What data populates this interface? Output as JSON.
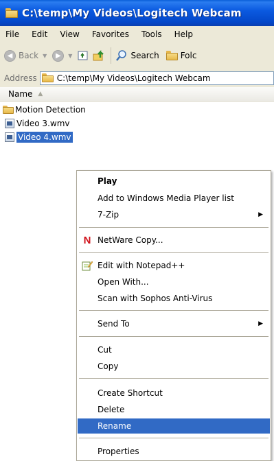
{
  "window": {
    "title": "C:\\temp\\My Videos\\Logitech Webcam"
  },
  "menubar": {
    "items": [
      "File",
      "Edit",
      "View",
      "Favorites",
      "Tools",
      "Help"
    ]
  },
  "toolbar": {
    "back_label": "Back",
    "search_label": "Search",
    "folders_label": "Folc"
  },
  "address": {
    "label": "Address",
    "path": "C:\\temp\\My Videos\\Logitech Webcam"
  },
  "columns": {
    "name": "Name"
  },
  "files": [
    {
      "name": "Motion Detection",
      "type": "folder"
    },
    {
      "name": "Video 3.wmv",
      "type": "video"
    },
    {
      "name": "Video 4.wmv",
      "type": "video",
      "selected": true
    }
  ],
  "context_menu": {
    "play": "Play",
    "add_wmp": "Add to Windows Media Player list",
    "zip": "7-Zip",
    "netware": "NetWare Copy...",
    "notepad": "Edit with Notepad++",
    "open_with": "Open With...",
    "sophos": "Scan with Sophos Anti-Virus",
    "send_to": "Send To",
    "cut": "Cut",
    "copy": "Copy",
    "create_shortcut": "Create Shortcut",
    "delete": "Delete",
    "rename": "Rename",
    "properties": "Properties",
    "highlighted": "Rename"
  },
  "colors": {
    "titlebar": "#0b5ae0",
    "selection": "#316ac5",
    "chrome": "#ece9d8",
    "netware_red": "#d0121b"
  }
}
